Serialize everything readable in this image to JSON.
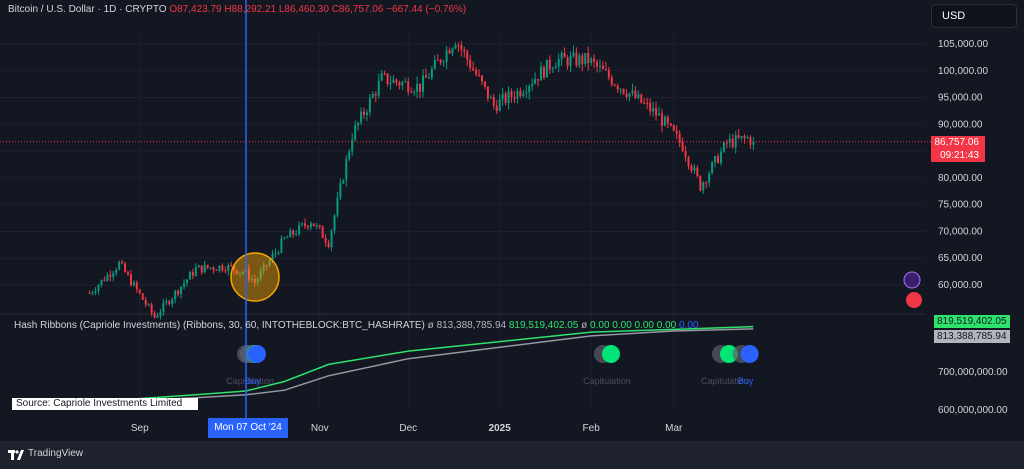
{
  "header": {
    "symbol": "Bitcoin / U.S. Dollar · 1D · CRYPTO",
    "ohlc": "O87,423.79 H88,292.21 L86,460.30 C86,757.06 −667.44 (−0.76%)"
  },
  "currency_button": "USD",
  "last_price": {
    "value": "86,757.06",
    "countdown": "09:21:43",
    "color": "#f23645"
  },
  "indicator": {
    "name": "Hash Ribbons (Capriole Investments) (Ribbons, 30, 60, INTOTHEBLOCK:BTC_HASHRATE)",
    "mark": "ø",
    "v1": "813,388,785.94",
    "v2": "819,519,402.05",
    "rest": "0.00 0.00 0.00 0.00",
    "v_last": "0.00",
    "tag_green": "819,519,402.05",
    "tag_grey": "813,388,785.94",
    "source": "Source: Capriole Investments Limited",
    "signal_labels": [
      "Capitulation",
      "Buy",
      "Capitulation",
      "Capitulation",
      "Buy"
    ]
  },
  "crosshair_date": "Mon 07 Oct '24",
  "footer": {
    "brand": "TradingView"
  },
  "colors": {
    "up": "#089981",
    "down": "#f23645",
    "accent": "#2962ff",
    "ribbon_fast": "#2ee36c",
    "ribbon_slow": "#9598a1",
    "circle": "#f7a600"
  },
  "chart_data": [
    {
      "type": "candlestick",
      "ylim": [
        55000,
        110000
      ],
      "y_ticks": [
        "105,000.00",
        "100,000.00",
        "95,000.00",
        "90,000.00",
        "85,000.00",
        "80,000.00",
        "75,000.00",
        "70,000.00",
        "65,000.00",
        "60,000.00"
      ],
      "x_ticks": [
        "Sep",
        "Nov",
        "Dec",
        "2025",
        "Feb",
        "Mar"
      ],
      "close_anchors": [
        [
          "2024-08-15",
          58500
        ],
        [
          "2024-08-25",
          64000
        ],
        [
          "2024-09-06",
          54000
        ],
        [
          "2024-09-20",
          63000
        ],
        [
          "2024-09-30",
          63500
        ],
        [
          "2024-10-07",
          62300
        ],
        [
          "2024-10-10",
          60500
        ],
        [
          "2024-10-20",
          68500
        ],
        [
          "2024-10-29",
          72000
        ],
        [
          "2024-11-04",
          68000
        ],
        [
          "2024-11-12",
          88000
        ],
        [
          "2024-11-22",
          98500
        ],
        [
          "2024-12-05",
          97000
        ],
        [
          "2024-12-17",
          106000
        ],
        [
          "2024-12-30",
          93500
        ],
        [
          "2025-01-07",
          96000
        ],
        [
          "2025-01-20",
          102000
        ],
        [
          "2025-01-31",
          102000
        ],
        [
          "2025-02-10",
          97500
        ],
        [
          "2025-02-24",
          91500
        ],
        [
          "2025-03-04",
          86000
        ],
        [
          "2025-03-10",
          78500
        ],
        [
          "2025-03-19",
          86500
        ],
        [
          "2025-03-26",
          87400
        ],
        [
          "2025-03-28",
          86757
        ]
      ],
      "last_close": 86757.06
    },
    {
      "type": "line",
      "title": "Hash Ribbons",
      "y_ticks": [
        "700,000,000.00",
        "600,000,000.00"
      ],
      "series": [
        {
          "name": "Ribbons 30",
          "color": "#2ee36c",
          "points": [
            [
              "2024-08-15",
              621000000
            ],
            [
              "2024-09-20",
              640000000
            ],
            [
              "2024-10-07",
              650000000
            ],
            [
              "2024-10-20",
              675000000
            ],
            [
              "2024-11-04",
              720000000
            ],
            [
              "2024-12-01",
              755000000
            ],
            [
              "2025-01-01",
              780000000
            ],
            [
              "2025-02-01",
              805000000
            ],
            [
              "2025-03-01",
              812000000
            ],
            [
              "2025-03-28",
              819519402
            ]
          ]
        },
        {
          "name": "Ribbons 60",
          "color": "#9598a1",
          "points": [
            [
              "2024-08-15",
              618000000
            ],
            [
              "2024-09-20",
              632000000
            ],
            [
              "2024-10-07",
              640000000
            ],
            [
              "2024-10-20",
              652000000
            ],
            [
              "2024-11-04",
              690000000
            ],
            [
              "2024-12-01",
              735000000
            ],
            [
              "2025-01-01",
              765000000
            ],
            [
              "2025-02-01",
              795000000
            ],
            [
              "2025-03-01",
              808000000
            ],
            [
              "2025-03-28",
              813388786
            ]
          ]
        }
      ],
      "signals": [
        {
          "date": "2024-10-07",
          "type": "Capitulation"
        },
        {
          "date": "2024-10-08",
          "type": "Buy"
        },
        {
          "date": "2025-02-05",
          "type": "Capitulation"
        },
        {
          "date": "2025-03-17",
          "type": "Capitulation"
        },
        {
          "date": "2025-03-24",
          "type": "Buy"
        }
      ]
    }
  ]
}
